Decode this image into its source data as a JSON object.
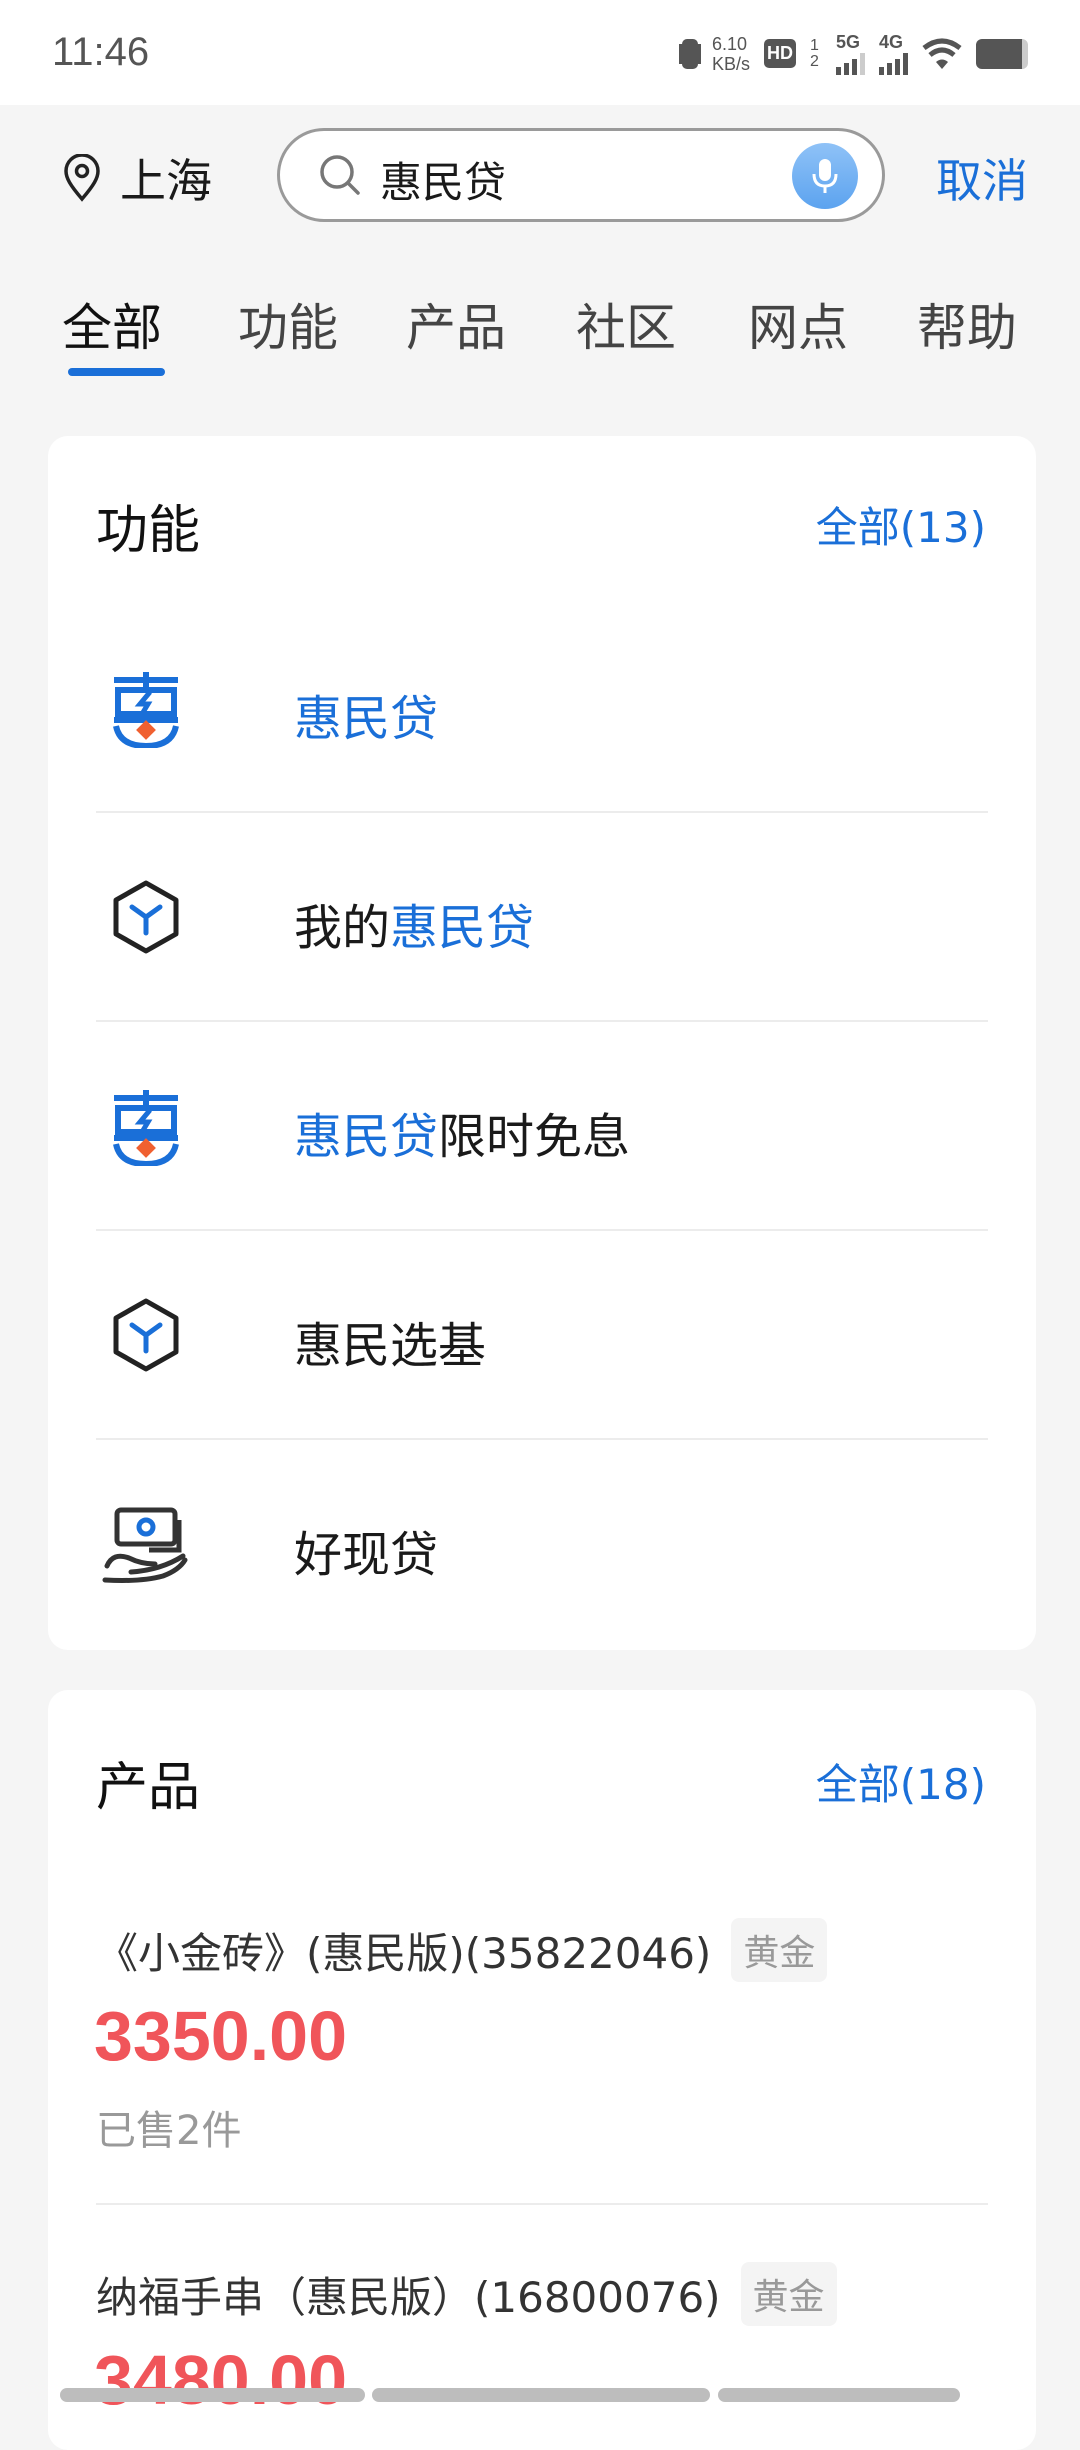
{
  "status_bar": {
    "time": "11:46",
    "net_speed": "6.10",
    "net_unit": "KB/s",
    "hd": "HD",
    "sim": "1 2",
    "net1": "5G",
    "net2": "4G"
  },
  "header": {
    "location": "上海",
    "search_value": "惠民贷",
    "cancel": "取消"
  },
  "tabs": [
    {
      "label": "全部",
      "active": true
    },
    {
      "label": "功能"
    },
    {
      "label": "产品"
    },
    {
      "label": "社区"
    },
    {
      "label": "网点"
    },
    {
      "label": "帮助"
    }
  ],
  "accent": "#1a6fd8",
  "functions": {
    "title": "功能",
    "all": "全部(13)",
    "items": [
      {
        "pre": "",
        "hl": "惠民贷",
        "post": "",
        "icon": "hui-logo-icon"
      },
      {
        "pre": "我的",
        "hl": "惠民贷",
        "post": "",
        "icon": "cube-icon"
      },
      {
        "pre": "",
        "hl": "惠民贷",
        "post": "限时免息",
        "icon": "hui-logo-icon"
      },
      {
        "pre": "惠民选基",
        "hl": "",
        "post": "",
        "icon": "cube-icon"
      },
      {
        "pre": "好现贷",
        "hl": "",
        "post": "",
        "icon": "cash-hand-icon"
      }
    ]
  },
  "products": {
    "title": "产品",
    "all": "全部(18)",
    "items": [
      {
        "name": "《小金砖》(惠民版)(35822046)",
        "tag": "黄金",
        "price": "3350.00",
        "sold": "已售2件"
      },
      {
        "name": "纳福手串（惠民版）(16800076)",
        "tag": "黄金",
        "price": "3480.00"
      }
    ]
  }
}
